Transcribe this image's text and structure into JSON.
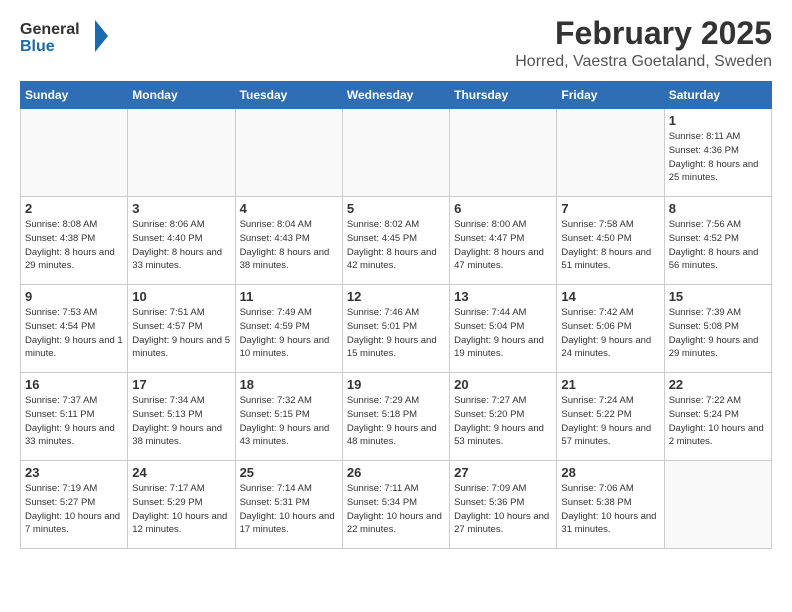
{
  "logo": {
    "general": "General",
    "blue": "Blue"
  },
  "header": {
    "month": "February 2025",
    "location": "Horred, Vaestra Goetaland, Sweden"
  },
  "weekdays": [
    "Sunday",
    "Monday",
    "Tuesday",
    "Wednesday",
    "Thursday",
    "Friday",
    "Saturday"
  ],
  "weeks": [
    [
      {
        "day": "",
        "info": ""
      },
      {
        "day": "",
        "info": ""
      },
      {
        "day": "",
        "info": ""
      },
      {
        "day": "",
        "info": ""
      },
      {
        "day": "",
        "info": ""
      },
      {
        "day": "",
        "info": ""
      },
      {
        "day": "1",
        "info": "Sunrise: 8:11 AM\nSunset: 4:36 PM\nDaylight: 8 hours and 25 minutes."
      }
    ],
    [
      {
        "day": "2",
        "info": "Sunrise: 8:08 AM\nSunset: 4:38 PM\nDaylight: 8 hours and 29 minutes."
      },
      {
        "day": "3",
        "info": "Sunrise: 8:06 AM\nSunset: 4:40 PM\nDaylight: 8 hours and 33 minutes."
      },
      {
        "day": "4",
        "info": "Sunrise: 8:04 AM\nSunset: 4:43 PM\nDaylight: 8 hours and 38 minutes."
      },
      {
        "day": "5",
        "info": "Sunrise: 8:02 AM\nSunset: 4:45 PM\nDaylight: 8 hours and 42 minutes."
      },
      {
        "day": "6",
        "info": "Sunrise: 8:00 AM\nSunset: 4:47 PM\nDaylight: 8 hours and 47 minutes."
      },
      {
        "day": "7",
        "info": "Sunrise: 7:58 AM\nSunset: 4:50 PM\nDaylight: 8 hours and 51 minutes."
      },
      {
        "day": "8",
        "info": "Sunrise: 7:56 AM\nSunset: 4:52 PM\nDaylight: 8 hours and 56 minutes."
      }
    ],
    [
      {
        "day": "9",
        "info": "Sunrise: 7:53 AM\nSunset: 4:54 PM\nDaylight: 9 hours and 1 minute."
      },
      {
        "day": "10",
        "info": "Sunrise: 7:51 AM\nSunset: 4:57 PM\nDaylight: 9 hours and 5 minutes."
      },
      {
        "day": "11",
        "info": "Sunrise: 7:49 AM\nSunset: 4:59 PM\nDaylight: 9 hours and 10 minutes."
      },
      {
        "day": "12",
        "info": "Sunrise: 7:46 AM\nSunset: 5:01 PM\nDaylight: 9 hours and 15 minutes."
      },
      {
        "day": "13",
        "info": "Sunrise: 7:44 AM\nSunset: 5:04 PM\nDaylight: 9 hours and 19 minutes."
      },
      {
        "day": "14",
        "info": "Sunrise: 7:42 AM\nSunset: 5:06 PM\nDaylight: 9 hours and 24 minutes."
      },
      {
        "day": "15",
        "info": "Sunrise: 7:39 AM\nSunset: 5:08 PM\nDaylight: 9 hours and 29 minutes."
      }
    ],
    [
      {
        "day": "16",
        "info": "Sunrise: 7:37 AM\nSunset: 5:11 PM\nDaylight: 9 hours and 33 minutes."
      },
      {
        "day": "17",
        "info": "Sunrise: 7:34 AM\nSunset: 5:13 PM\nDaylight: 9 hours and 38 minutes."
      },
      {
        "day": "18",
        "info": "Sunrise: 7:32 AM\nSunset: 5:15 PM\nDaylight: 9 hours and 43 minutes."
      },
      {
        "day": "19",
        "info": "Sunrise: 7:29 AM\nSunset: 5:18 PM\nDaylight: 9 hours and 48 minutes."
      },
      {
        "day": "20",
        "info": "Sunrise: 7:27 AM\nSunset: 5:20 PM\nDaylight: 9 hours and 53 minutes."
      },
      {
        "day": "21",
        "info": "Sunrise: 7:24 AM\nSunset: 5:22 PM\nDaylight: 9 hours and 57 minutes."
      },
      {
        "day": "22",
        "info": "Sunrise: 7:22 AM\nSunset: 5:24 PM\nDaylight: 10 hours and 2 minutes."
      }
    ],
    [
      {
        "day": "23",
        "info": "Sunrise: 7:19 AM\nSunset: 5:27 PM\nDaylight: 10 hours and 7 minutes."
      },
      {
        "day": "24",
        "info": "Sunrise: 7:17 AM\nSunset: 5:29 PM\nDaylight: 10 hours and 12 minutes."
      },
      {
        "day": "25",
        "info": "Sunrise: 7:14 AM\nSunset: 5:31 PM\nDaylight: 10 hours and 17 minutes."
      },
      {
        "day": "26",
        "info": "Sunrise: 7:11 AM\nSunset: 5:34 PM\nDaylight: 10 hours and 22 minutes."
      },
      {
        "day": "27",
        "info": "Sunrise: 7:09 AM\nSunset: 5:36 PM\nDaylight: 10 hours and 27 minutes."
      },
      {
        "day": "28",
        "info": "Sunrise: 7:06 AM\nSunset: 5:38 PM\nDaylight: 10 hours and 31 minutes."
      },
      {
        "day": "",
        "info": ""
      }
    ]
  ]
}
